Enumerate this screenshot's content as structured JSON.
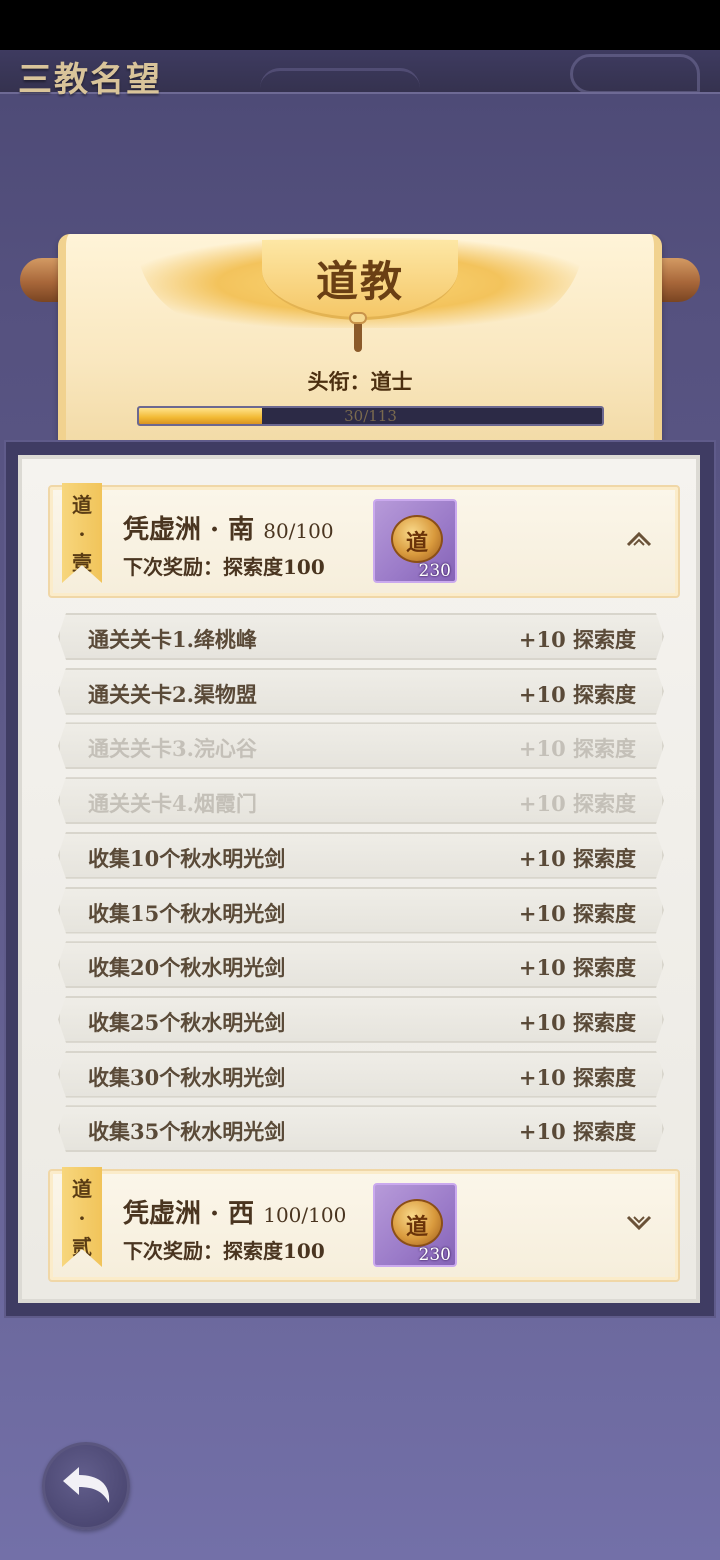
{
  "header": {
    "title": "三教名望"
  },
  "scroll": {
    "sect_name": "道教",
    "rank_label": "头衔：",
    "rank_value": "道士",
    "progress_text": "30/113",
    "progress_fraction": 0.2655
  },
  "sections": [
    {
      "ribbon": [
        "道",
        "·",
        "壹"
      ],
      "name": "凭虚洲 · 南",
      "count": "80/100",
      "reward_label": "下次奖励：探索度100",
      "item_glyph": "道",
      "item_qty": "230",
      "chevron": "chevron-up-icon"
    },
    {
      "ribbon": [
        "道",
        "·",
        "贰"
      ],
      "name": "凭虚洲 · 西",
      "count": "100/100",
      "reward_label": "下次奖励：探索度100",
      "item_glyph": "道",
      "item_qty": "230",
      "chevron": "chevron-down-icon"
    }
  ],
  "tasks": [
    {
      "label": "通关关卡1.绛桃峰",
      "reward": "+10 探索度",
      "done": false
    },
    {
      "label": "通关关卡2.渠物盟",
      "reward": "+10 探索度",
      "done": false
    },
    {
      "label": "通关关卡3.浣心谷",
      "reward": "+10 探索度",
      "done": true
    },
    {
      "label": "通关关卡4.烟霞门",
      "reward": "+10 探索度",
      "done": true
    },
    {
      "label": "收集10个秋水明光剑",
      "reward": "+10 探索度",
      "done": false
    },
    {
      "label": "收集15个秋水明光剑",
      "reward": "+10 探索度",
      "done": false
    },
    {
      "label": "收集20个秋水明光剑",
      "reward": "+10 探索度",
      "done": false
    },
    {
      "label": "收集25个秋水明光剑",
      "reward": "+10 探索度",
      "done": false
    },
    {
      "label": "收集30个秋水明光剑",
      "reward": "+10 探索度",
      "done": false
    },
    {
      "label": "收集35个秋水明光剑",
      "reward": "+10 探索度",
      "done": false
    }
  ],
  "footer": {
    "back_icon": "back-arrow-icon"
  }
}
